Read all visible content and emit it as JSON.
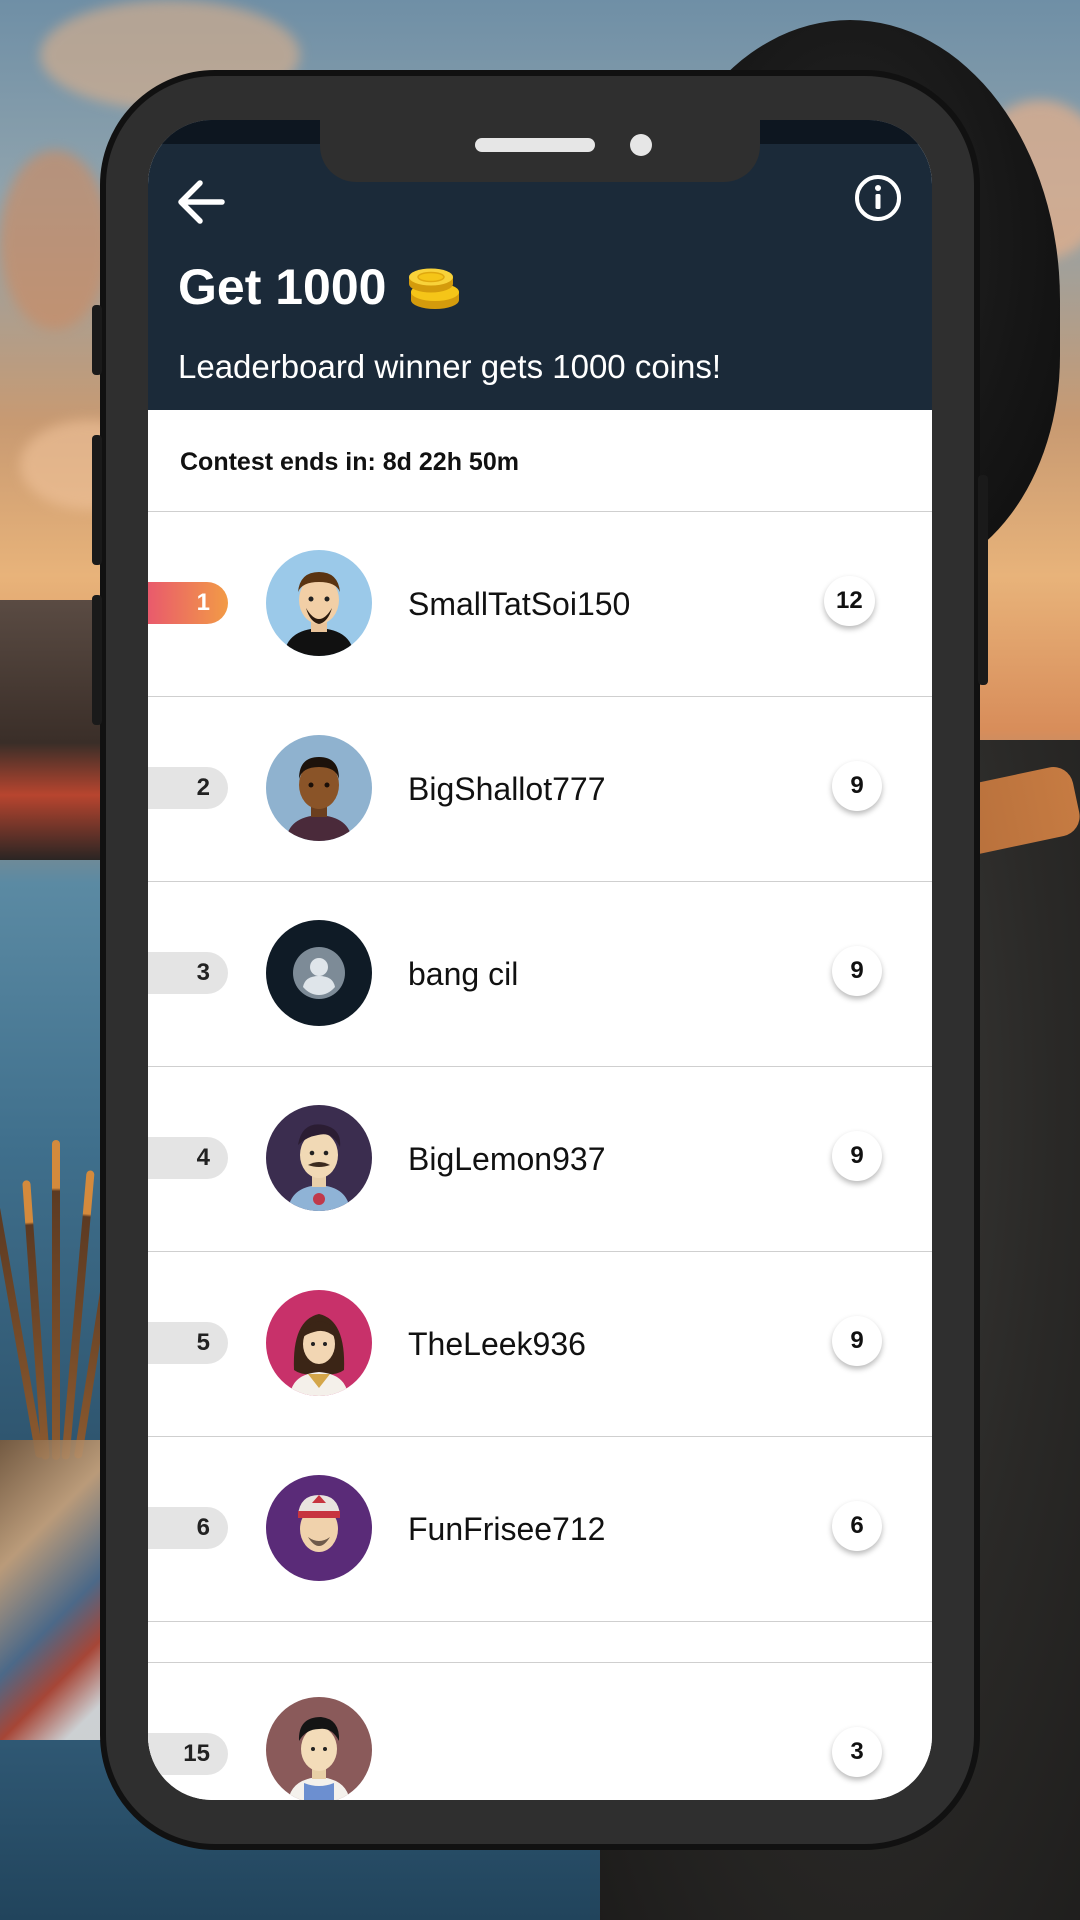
{
  "app": {
    "title": "Get 1000",
    "subtitle": "Leaderboard winner gets 1000 coins!",
    "icons": {
      "back": "arrow-left-icon",
      "info": "info-circle-icon",
      "coins": "coin-stack-icon"
    }
  },
  "contest": {
    "ends_text": "Contest ends in: 8d 22h 50m"
  },
  "leaderboard": {
    "rows": [
      {
        "rank": "1",
        "name": "SmallTatSoi150",
        "score": "12",
        "avatar": "avatar-man-beard"
      },
      {
        "rank": "2",
        "name": "BigShallot777",
        "score": "9",
        "avatar": "avatar-man-dark"
      },
      {
        "rank": "3",
        "name": "bang cil",
        "score": "9",
        "avatar": "avatar-default-user"
      },
      {
        "rank": "4",
        "name": "BigLemon937",
        "score": "9",
        "avatar": "avatar-man-mustache"
      },
      {
        "rank": "5",
        "name": "TheLeek936",
        "score": "9",
        "avatar": "avatar-woman"
      },
      {
        "rank": "6",
        "name": "FunFrisee712",
        "score": "6",
        "avatar": "avatar-man-headband"
      }
    ]
  },
  "own_entry": {
    "rank": "15",
    "name": "",
    "score": "3",
    "avatar": "avatar-boy-apron"
  },
  "navbar": {
    "icons": [
      "recent-apps-icon",
      "home-icon",
      "back-nav-icon"
    ]
  },
  "colors": {
    "header": "#1b2a39",
    "rank_first_from": "#e95a6c",
    "rank_first_to": "#f29b46",
    "rank_default": "#e4e4e4"
  }
}
